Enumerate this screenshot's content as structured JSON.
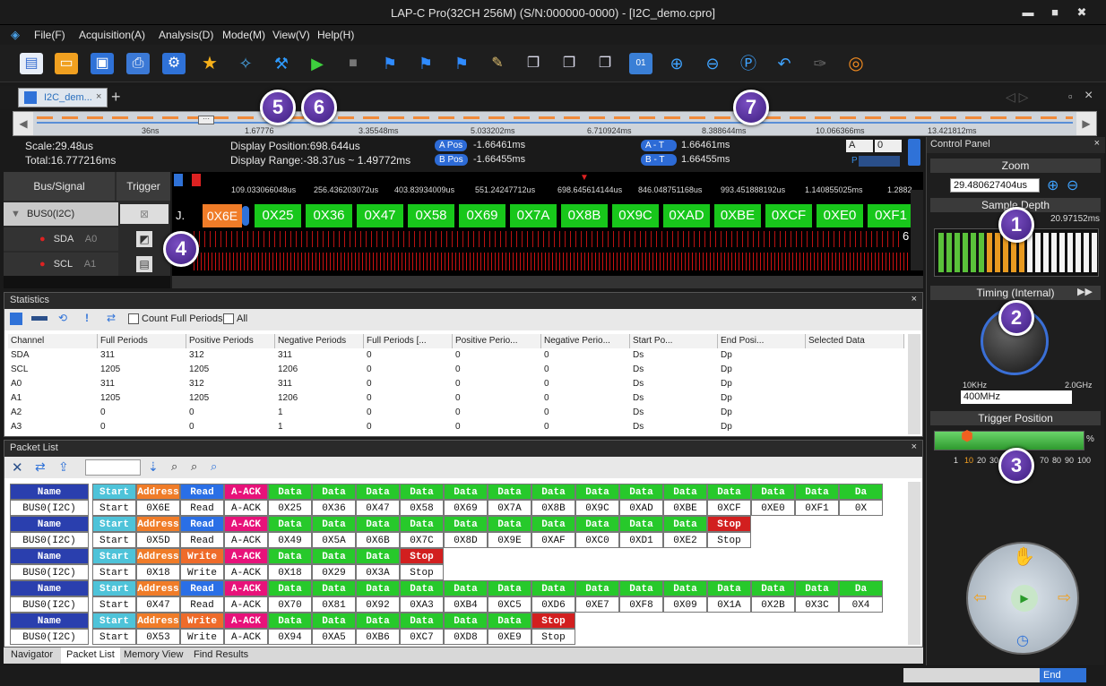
{
  "window": {
    "title": "LAP-C Pro(32CH 256M) (S/N:000000-0000) - [I2C_demo.cpro]",
    "min": "▬",
    "max": "■",
    "close": "✖"
  },
  "menu": [
    "File(F)",
    "Acquisition(A)",
    "Analysis(D)",
    "Mode(M)",
    "View(V)",
    "Help(H)"
  ],
  "tab": {
    "label": "I2C_dem...",
    "close": "×",
    "add": "+"
  },
  "overview": {
    "ticks": [
      "36ns",
      "1.67776",
      "3.35548ms",
      "5.033202ms",
      "6.710924ms",
      "8.388644ms",
      "10.066366ms",
      "13.421812ms"
    ]
  },
  "info": {
    "scale": "Scale:29.48us",
    "total": "Total:16.777216ms",
    "position": "Display Position:698.644us",
    "range": "Display Range:-38.37us ~ 1.49772ms",
    "apos_label": "A Pos",
    "apos": "-1.66461ms",
    "bpos_label": "B Pos",
    "bpos": "-1.66455ms",
    "at_label": "A - T",
    "at": "1.66461ms",
    "bt_label": "B - T",
    "bt": "1.66455ms",
    "sel_a": "A",
    "sel_0": "0",
    "p_label": "P"
  },
  "signals": {
    "head_bus": "Bus/Signal",
    "head_trigger": "Trigger",
    "bus": "BUS0(I2C)",
    "sda": "SDA",
    "sda_ch": "A0",
    "scl": "SCL",
    "scl_ch": "A1"
  },
  "wave": {
    "time_ticks": [
      "109.033066048us",
      "256.436203072us",
      "403.83934009us",
      "551.24247712us",
      "698.645614144us",
      "846.048751168us",
      "993.451888192us",
      "1.140855025ms",
      "1.2882"
    ],
    "bytes": [
      "0X6E",
      "0X25",
      "0X36",
      "0X47",
      "0X58",
      "0X69",
      "0X7A",
      "0X8B",
      "0X9C",
      "0XAD",
      "0XBE",
      "0XCF",
      "0XE0",
      "0XF1"
    ],
    "prefix": "J.",
    "sda_end": "6"
  },
  "callouts": [
    "1",
    "2",
    "3",
    "4",
    "5",
    "6",
    "7"
  ],
  "stats": {
    "title": "Statistics",
    "close": "×",
    "count_full": "Count Full Periods",
    "all": "All",
    "columns": [
      "Channel",
      "Full Periods",
      "Positive Periods",
      "Negative Periods",
      "Full Periods [...",
      "Positive Perio...",
      "Negative Perio...",
      "Start Po...",
      "End Posi...",
      "Selected Data"
    ],
    "rows": [
      [
        "SDA",
        "311",
        "312",
        "311",
        "0",
        "0",
        "0",
        "Ds",
        "Dp",
        ""
      ],
      [
        "SCL",
        "1205",
        "1205",
        "1206",
        "0",
        "0",
        "0",
        "Ds",
        "Dp",
        ""
      ],
      [
        "A0",
        "311",
        "312",
        "311",
        "0",
        "0",
        "0",
        "Ds",
        "Dp",
        ""
      ],
      [
        "A1",
        "1205",
        "1205",
        "1206",
        "0",
        "0",
        "0",
        "Ds",
        "Dp",
        ""
      ],
      [
        "A2",
        "0",
        "0",
        "1",
        "0",
        "0",
        "0",
        "Ds",
        "Dp",
        ""
      ],
      [
        "A3",
        "0",
        "0",
        "1",
        "0",
        "0",
        "0",
        "Ds",
        "Dp",
        ""
      ]
    ]
  },
  "packets": {
    "title": "Packet List",
    "close": "×",
    "rows": [
      [
        [
          "Name",
          "BUS0(I2C)",
          "n"
        ],
        [
          "Start",
          "Start",
          "s"
        ],
        [
          "Address",
          "0X6E",
          "a"
        ],
        [
          "Read",
          "Read",
          "r"
        ],
        [
          "A-ACK",
          "A-ACK",
          "k"
        ],
        [
          "Data",
          "0X25",
          "d"
        ],
        [
          "Data",
          "0X36",
          "d"
        ],
        [
          "Data",
          "0X47",
          "d"
        ],
        [
          "Data",
          "0X58",
          "d"
        ],
        [
          "Data",
          "0X69",
          "d"
        ],
        [
          "Data",
          "0X7A",
          "d"
        ],
        [
          "Data",
          "0X8B",
          "d"
        ],
        [
          "Data",
          "0X9C",
          "d"
        ],
        [
          "Data",
          "0XAD",
          "d"
        ],
        [
          "Data",
          "0XBE",
          "d"
        ],
        [
          "Data",
          "0XCF",
          "d"
        ],
        [
          "Data",
          "0XE0",
          "d"
        ],
        [
          "Data",
          "0XF1",
          "d"
        ],
        [
          "Da",
          "0X",
          "d"
        ]
      ],
      [
        [
          "Name",
          "BUS0(I2C)",
          "n"
        ],
        [
          "Start",
          "Start",
          "s"
        ],
        [
          "Address",
          "0X5D",
          "a"
        ],
        [
          "Read",
          "Read",
          "r"
        ],
        [
          "A-ACK",
          "A-ACK",
          "k"
        ],
        [
          "Data",
          "0X49",
          "d"
        ],
        [
          "Data",
          "0X5A",
          "d"
        ],
        [
          "Data",
          "0X6B",
          "d"
        ],
        [
          "Data",
          "0X7C",
          "d"
        ],
        [
          "Data",
          "0X8D",
          "d"
        ],
        [
          "Data",
          "0X9E",
          "d"
        ],
        [
          "Data",
          "0XAF",
          "d"
        ],
        [
          "Data",
          "0XC0",
          "d"
        ],
        [
          "Data",
          "0XD1",
          "d"
        ],
        [
          "Data",
          "0XE2",
          "d"
        ],
        [
          "Stop",
          "Stop",
          "p"
        ]
      ],
      [
        [
          "Name",
          "BUS0(I2C)",
          "n"
        ],
        [
          "Start",
          "Start",
          "s"
        ],
        [
          "Address",
          "0X18",
          "a"
        ],
        [
          "Write",
          "Write",
          "w"
        ],
        [
          "A-ACK",
          "A-ACK",
          "k"
        ],
        [
          "Data",
          "0X18",
          "d"
        ],
        [
          "Data",
          "0X29",
          "d"
        ],
        [
          "Data",
          "0X3A",
          "d"
        ],
        [
          "Stop",
          "Stop",
          "p"
        ]
      ],
      [
        [
          "Name",
          "BUS0(I2C)",
          "n"
        ],
        [
          "Start",
          "Start",
          "s"
        ],
        [
          "Address",
          "0X47",
          "a"
        ],
        [
          "Read",
          "Read",
          "r"
        ],
        [
          "A-ACK",
          "A-ACK",
          "k"
        ],
        [
          "Data",
          "0X70",
          "d"
        ],
        [
          "Data",
          "0X81",
          "d"
        ],
        [
          "Data",
          "0X92",
          "d"
        ],
        [
          "Data",
          "0XA3",
          "d"
        ],
        [
          "Data",
          "0XB4",
          "d"
        ],
        [
          "Data",
          "0XC5",
          "d"
        ],
        [
          "Data",
          "0XD6",
          "d"
        ],
        [
          "Data",
          "0XE7",
          "d"
        ],
        [
          "Data",
          "0XF8",
          "d"
        ],
        [
          "Data",
          "0X09",
          "d"
        ],
        [
          "Data",
          "0X1A",
          "d"
        ],
        [
          "Data",
          "0X2B",
          "d"
        ],
        [
          "Data",
          "0X3C",
          "d"
        ],
        [
          "Da",
          "0X4",
          "d"
        ]
      ],
      [
        [
          "Name",
          "BUS0(I2C)",
          "n"
        ],
        [
          "Start",
          "Start",
          "s"
        ],
        [
          "Address",
          "0X53",
          "a"
        ],
        [
          "Write",
          "Write",
          "w"
        ],
        [
          "A-ACK",
          "A-ACK",
          "k"
        ],
        [
          "Data",
          "0X94",
          "d"
        ],
        [
          "Data",
          "0XA5",
          "d"
        ],
        [
          "Data",
          "0XB6",
          "d"
        ],
        [
          "Data",
          "0XC7",
          "d"
        ],
        [
          "Data",
          "0XD8",
          "d"
        ],
        [
          "Data",
          "0XE9",
          "d"
        ],
        [
          "Stop",
          "Stop",
          "p"
        ]
      ]
    ]
  },
  "bottom_tabs": [
    "Navigator",
    "Packet List",
    "Memory View",
    "Find Results"
  ],
  "status": {
    "end": "End"
  },
  "control": {
    "title": "Control Panel",
    "zoom": "Zoom",
    "zoom_value": "29.480627404us",
    "depth": "Sample Depth",
    "depth_value": "20.97152ms",
    "timing": "Timing (Internal)",
    "freq_min": "10KHz",
    "freq_max": "2.0GHz",
    "freq_value": "400MHz",
    "trigger_pos": "Trigger Position",
    "pct": "%",
    "scale": [
      "1",
      "10",
      "20",
      "30",
      "",
      "",
      "70",
      "80",
      "90",
      "100"
    ]
  },
  "colors": {
    "n": "#2a3fae",
    "s": "#4ec3d9",
    "a": "#f07c28",
    "r": "#2a6fe6",
    "w": "#ef6b2a",
    "k": "#e8127a",
    "d": "#27c92b",
    "p": "#d21f1f"
  }
}
